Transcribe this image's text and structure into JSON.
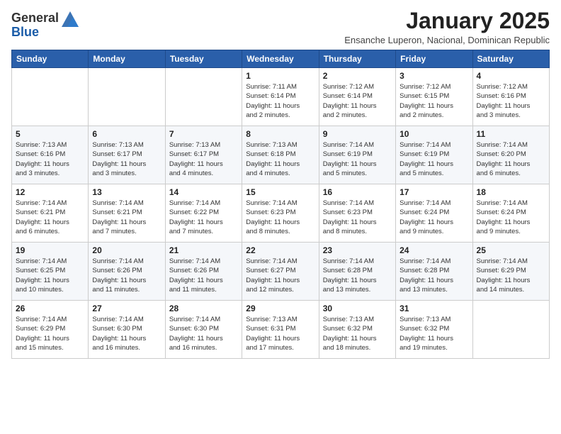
{
  "logo": {
    "general": "General",
    "blue": "Blue"
  },
  "title": "January 2025",
  "subtitle": "Ensanche Luperon, Nacional, Dominican Republic",
  "days_of_week": [
    "Sunday",
    "Monday",
    "Tuesday",
    "Wednesday",
    "Thursday",
    "Friday",
    "Saturday"
  ],
  "weeks": [
    [
      {
        "day": "",
        "info": ""
      },
      {
        "day": "",
        "info": ""
      },
      {
        "day": "",
        "info": ""
      },
      {
        "day": "1",
        "info": "Sunrise: 7:11 AM\nSunset: 6:14 PM\nDaylight: 11 hours\nand 2 minutes."
      },
      {
        "day": "2",
        "info": "Sunrise: 7:12 AM\nSunset: 6:14 PM\nDaylight: 11 hours\nand 2 minutes."
      },
      {
        "day": "3",
        "info": "Sunrise: 7:12 AM\nSunset: 6:15 PM\nDaylight: 11 hours\nand 2 minutes."
      },
      {
        "day": "4",
        "info": "Sunrise: 7:12 AM\nSunset: 6:16 PM\nDaylight: 11 hours\nand 3 minutes."
      }
    ],
    [
      {
        "day": "5",
        "info": "Sunrise: 7:13 AM\nSunset: 6:16 PM\nDaylight: 11 hours\nand 3 minutes."
      },
      {
        "day": "6",
        "info": "Sunrise: 7:13 AM\nSunset: 6:17 PM\nDaylight: 11 hours\nand 3 minutes."
      },
      {
        "day": "7",
        "info": "Sunrise: 7:13 AM\nSunset: 6:17 PM\nDaylight: 11 hours\nand 4 minutes."
      },
      {
        "day": "8",
        "info": "Sunrise: 7:13 AM\nSunset: 6:18 PM\nDaylight: 11 hours\nand 4 minutes."
      },
      {
        "day": "9",
        "info": "Sunrise: 7:14 AM\nSunset: 6:19 PM\nDaylight: 11 hours\nand 5 minutes."
      },
      {
        "day": "10",
        "info": "Sunrise: 7:14 AM\nSunset: 6:19 PM\nDaylight: 11 hours\nand 5 minutes."
      },
      {
        "day": "11",
        "info": "Sunrise: 7:14 AM\nSunset: 6:20 PM\nDaylight: 11 hours\nand 6 minutes."
      }
    ],
    [
      {
        "day": "12",
        "info": "Sunrise: 7:14 AM\nSunset: 6:21 PM\nDaylight: 11 hours\nand 6 minutes."
      },
      {
        "day": "13",
        "info": "Sunrise: 7:14 AM\nSunset: 6:21 PM\nDaylight: 11 hours\nand 7 minutes."
      },
      {
        "day": "14",
        "info": "Sunrise: 7:14 AM\nSunset: 6:22 PM\nDaylight: 11 hours\nand 7 minutes."
      },
      {
        "day": "15",
        "info": "Sunrise: 7:14 AM\nSunset: 6:23 PM\nDaylight: 11 hours\nand 8 minutes."
      },
      {
        "day": "16",
        "info": "Sunrise: 7:14 AM\nSunset: 6:23 PM\nDaylight: 11 hours\nand 8 minutes."
      },
      {
        "day": "17",
        "info": "Sunrise: 7:14 AM\nSunset: 6:24 PM\nDaylight: 11 hours\nand 9 minutes."
      },
      {
        "day": "18",
        "info": "Sunrise: 7:14 AM\nSunset: 6:24 PM\nDaylight: 11 hours\nand 9 minutes."
      }
    ],
    [
      {
        "day": "19",
        "info": "Sunrise: 7:14 AM\nSunset: 6:25 PM\nDaylight: 11 hours\nand 10 minutes."
      },
      {
        "day": "20",
        "info": "Sunrise: 7:14 AM\nSunset: 6:26 PM\nDaylight: 11 hours\nand 11 minutes."
      },
      {
        "day": "21",
        "info": "Sunrise: 7:14 AM\nSunset: 6:26 PM\nDaylight: 11 hours\nand 11 minutes."
      },
      {
        "day": "22",
        "info": "Sunrise: 7:14 AM\nSunset: 6:27 PM\nDaylight: 11 hours\nand 12 minutes."
      },
      {
        "day": "23",
        "info": "Sunrise: 7:14 AM\nSunset: 6:28 PM\nDaylight: 11 hours\nand 13 minutes."
      },
      {
        "day": "24",
        "info": "Sunrise: 7:14 AM\nSunset: 6:28 PM\nDaylight: 11 hours\nand 13 minutes."
      },
      {
        "day": "25",
        "info": "Sunrise: 7:14 AM\nSunset: 6:29 PM\nDaylight: 11 hours\nand 14 minutes."
      }
    ],
    [
      {
        "day": "26",
        "info": "Sunrise: 7:14 AM\nSunset: 6:29 PM\nDaylight: 11 hours\nand 15 minutes."
      },
      {
        "day": "27",
        "info": "Sunrise: 7:14 AM\nSunset: 6:30 PM\nDaylight: 11 hours\nand 16 minutes."
      },
      {
        "day": "28",
        "info": "Sunrise: 7:14 AM\nSunset: 6:30 PM\nDaylight: 11 hours\nand 16 minutes."
      },
      {
        "day": "29",
        "info": "Sunrise: 7:13 AM\nSunset: 6:31 PM\nDaylight: 11 hours\nand 17 minutes."
      },
      {
        "day": "30",
        "info": "Sunrise: 7:13 AM\nSunset: 6:32 PM\nDaylight: 11 hours\nand 18 minutes."
      },
      {
        "day": "31",
        "info": "Sunrise: 7:13 AM\nSunset: 6:32 PM\nDaylight: 11 hours\nand 19 minutes."
      },
      {
        "day": "",
        "info": ""
      }
    ]
  ]
}
